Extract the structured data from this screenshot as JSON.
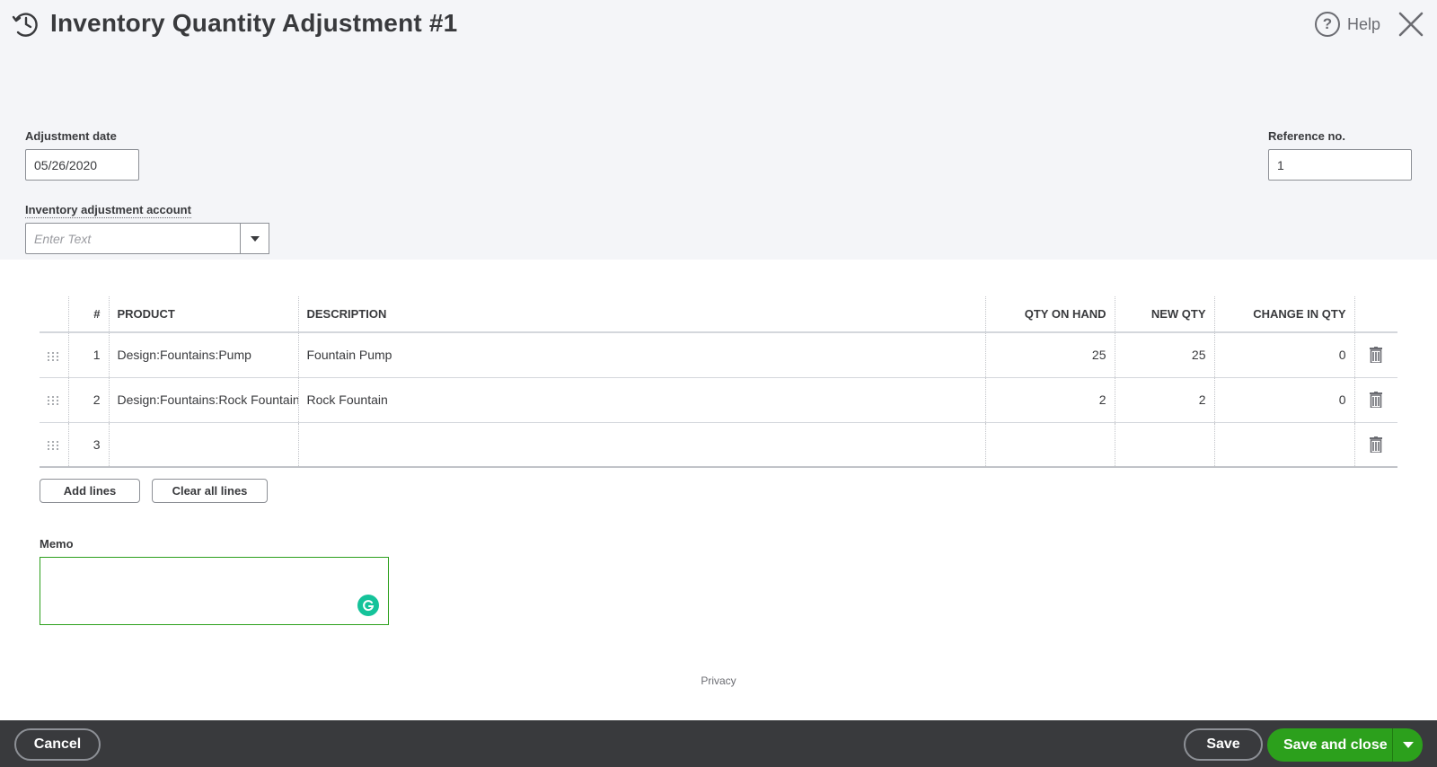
{
  "header": {
    "title": "Inventory Quantity Adjustment #1",
    "help_label": "Help"
  },
  "form": {
    "adjustment_date_label": "Adjustment date",
    "adjustment_date_value": "05/26/2020",
    "reference_label": "Reference no.",
    "reference_value": "1",
    "account_label": "Inventory adjustment account",
    "account_placeholder": "Enter Text"
  },
  "table": {
    "headers": {
      "line": "#",
      "product": "PRODUCT",
      "description": "DESCRIPTION",
      "qty_on_hand": "QTY ON HAND",
      "new_qty": "NEW QTY",
      "change_in_qty": "CHANGE IN QTY"
    },
    "rows": [
      {
        "line": "1",
        "product": "Design:Fountains:Pump",
        "description": "Fountain Pump",
        "qty_on_hand": "25",
        "new_qty": "25",
        "change_in_qty": "0"
      },
      {
        "line": "2",
        "product": "Design:Fountains:Rock Fountain",
        "description": "Rock Fountain",
        "qty_on_hand": "2",
        "new_qty": "2",
        "change_in_qty": "0"
      },
      {
        "line": "3",
        "product": "",
        "description": "",
        "qty_on_hand": "",
        "new_qty": "",
        "change_in_qty": ""
      }
    ]
  },
  "actions": {
    "add_lines": "Add lines",
    "clear_all_lines": "Clear all lines"
  },
  "memo": {
    "label": "Memo",
    "value": ""
  },
  "privacy": "Privacy",
  "footer": {
    "cancel": "Cancel",
    "save": "Save",
    "save_and_close": "Save and close"
  },
  "colors": {
    "header_bg": "#f4f5f8",
    "footer_bg": "#393a3d",
    "primary_green": "#2ca01c",
    "grammarly_green": "#15c39a",
    "text": "#393a3d"
  },
  "icons": [
    "recent-transactions-icon",
    "help-icon",
    "close-icon",
    "dropdown-arrow-icon",
    "drag-handle-icon",
    "trash-icon",
    "grammarly-icon",
    "chevron-down-icon"
  ]
}
